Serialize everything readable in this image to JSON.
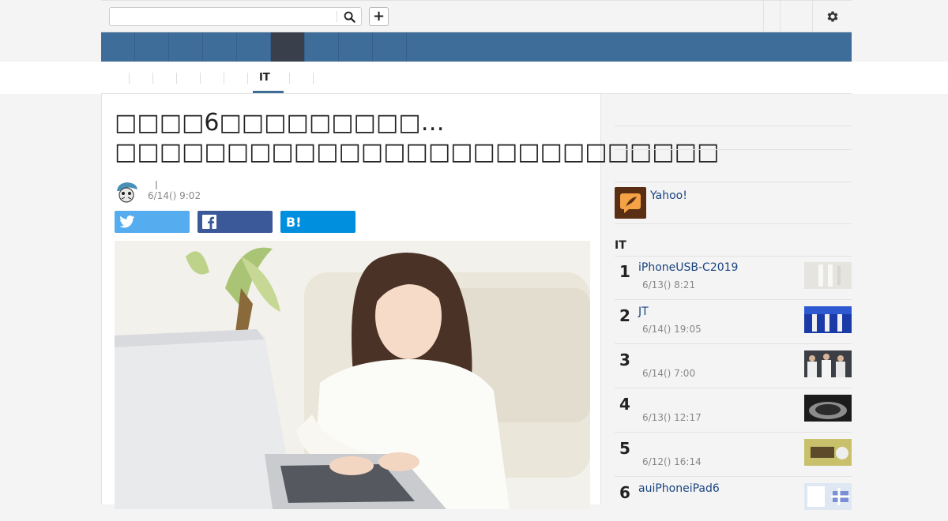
{
  "header": {
    "search": {
      "value": "",
      "placeholder": ""
    },
    "plus_label": "+",
    "nav": {
      "item_count": 9,
      "active_index": 5
    }
  },
  "subnav": {
    "active_tab": "IT"
  },
  "article": {
    "title": "□□□□6□□□□□□□□□…□□□□□□□□□□□□□□□□□□□□□□□□□□□",
    "byline_separator": "|",
    "date": "6/14() 9:02"
  },
  "sidebar": {
    "yahoo_link": "Yahoo!",
    "ranking_heading": "IT",
    "ranking": [
      {
        "rank": "1",
        "title": "iPhoneUSB-C2019",
        "date": "6/13() 8:21",
        "thumb": "cables-thumb"
      },
      {
        "rank": "2",
        "title": "JT",
        "date": "6/14() 19:05",
        "thumb": "event-thumb"
      },
      {
        "rank": "3",
        "title": "",
        "date": "6/14() 7:00",
        "thumb": "people-thumb"
      },
      {
        "rank": "4",
        "title": "",
        "date": "6/13() 12:17",
        "thumb": "device-thumb"
      },
      {
        "rank": "5",
        "title": "",
        "date": "6/12() 16:14",
        "thumb": "food-thumb"
      },
      {
        "rank": "6",
        "title": "auiPhoneiPad6",
        "date": "",
        "thumb": "phone-thumb"
      }
    ]
  },
  "colors": {
    "nav_bg": "#3f6d99",
    "nav_active": "#39404b",
    "twitter": "#55acee",
    "facebook": "#3b5998",
    "hatena": "#008fde",
    "link": "#1a4480"
  }
}
